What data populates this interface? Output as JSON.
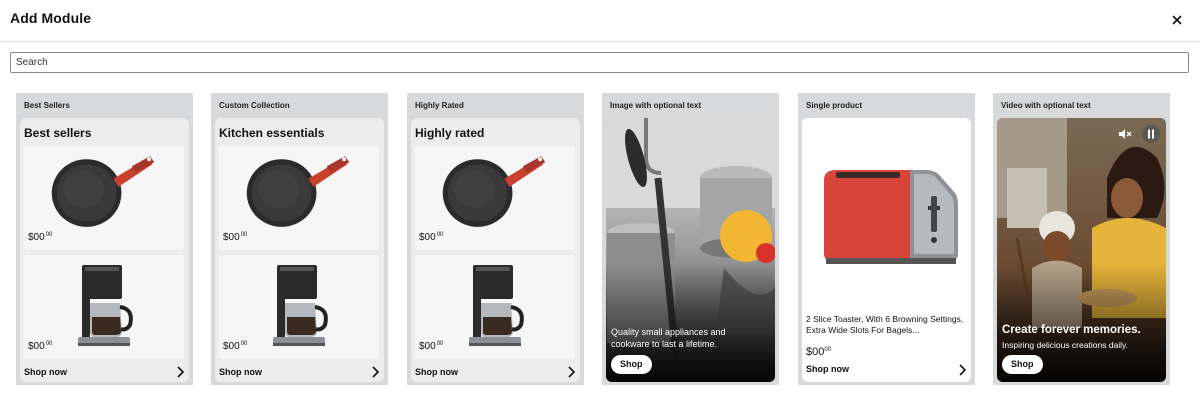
{
  "header": {
    "title": "Add Module",
    "close_icon": "close-icon"
  },
  "search": {
    "placeholder": "Search",
    "value": ""
  },
  "modules": [
    {
      "label": "Best Sellers",
      "heading": "Best sellers",
      "products": [
        {
          "price_main": "$00",
          "price_sup": "00",
          "icon": "frying-pan-icon"
        },
        {
          "price_main": "$00",
          "price_sup": "00",
          "icon": "coffee-maker-icon"
        }
      ],
      "cta": "Shop now",
      "cta_icon": "chevron-right-icon"
    },
    {
      "label": "Custom Collection",
      "heading": "Kitchen essentials",
      "products": [
        {
          "price_main": "$00",
          "price_sup": "00",
          "icon": "frying-pan-icon"
        },
        {
          "price_main": "$00",
          "price_sup": "00",
          "icon": "coffee-maker-icon"
        }
      ],
      "cta": "Shop now",
      "cta_icon": "chevron-right-icon"
    },
    {
      "label": "Highly Rated",
      "heading": "Highly rated",
      "products": [
        {
          "price_main": "$00",
          "price_sup": "00",
          "icon": "frying-pan-icon"
        },
        {
          "price_main": "$00",
          "price_sup": "00",
          "icon": "coffee-maker-icon"
        }
      ],
      "cta": "Shop now",
      "cta_icon": "chevron-right-icon"
    },
    {
      "label": "Image with optional text",
      "caption": "Quality small appliances and cookware to last a lifetime.",
      "cta": "Shop",
      "image": "cookware-photo"
    },
    {
      "label": "Single product",
      "description": "2 Slice Toaster, With 6 Browning Settings, Extra Wide Slots For Bagels...",
      "price_main": "$00",
      "price_sup": "00",
      "cta": "Shop now",
      "cta_icon": "chevron-right-icon",
      "image": "toaster-photo"
    },
    {
      "label": "Video with optional text",
      "headline": "Create forever memories.",
      "subline": "Inspiring delicious creations daily.",
      "cta": "Shop",
      "controls": [
        "mute-icon",
        "pause-icon"
      ],
      "image": "family-cooking-video"
    }
  ],
  "colors": {
    "card_bg": "#d8d9da",
    "inner_bg": "#ececec",
    "pan_handle": "#c8412f",
    "toaster_red": "#d8433a"
  }
}
